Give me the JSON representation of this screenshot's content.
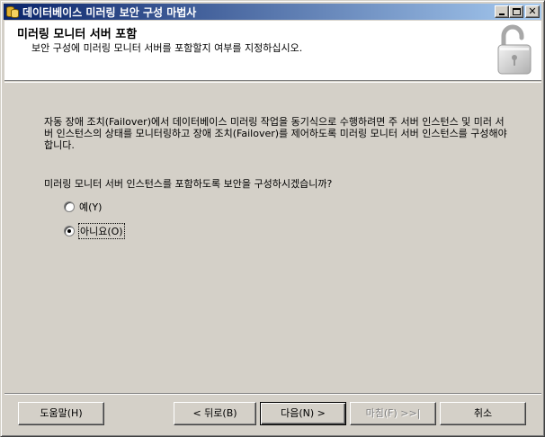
{
  "window": {
    "title": "데이터베이스 미러링 보안 구성 마법사",
    "minimize_glyph": "_",
    "maximize_glyph": "□",
    "close_glyph": "✕"
  },
  "header": {
    "title": "미러링 모니터 서버 포함",
    "subtitle": "보안 구성에 미러링 모니터 서버를 포함할지 여부를 지정하십시오.",
    "icon": "padlock-icon"
  },
  "body": {
    "description": "자동 장애 조치(Failover)에서 데이터베이스 미러링 작업을 동기식으로 수행하려면 주 서버 인스턴스 및 미러 서버 인스턴스의 상태를 모니터링하고 장애 조치(Failover)를 제어하도록 미러링 모니터 서버 인스턴스를 구성해야 합니다.",
    "question": "미러링 모니터 서버 인스턴스를 포함하도록 보안을 구성하시겠습니까?",
    "options": [
      {
        "label": "예(Y)",
        "selected": false
      },
      {
        "label": "아니요(O)",
        "selected": true
      }
    ]
  },
  "buttons": {
    "help": "도움말(H)",
    "back": "< 뒤로(B)",
    "next": "다음(N) >",
    "finish": "마침(F) >>|",
    "cancel": "취소"
  },
  "colors": {
    "titlebar_start": "#0a246a",
    "titlebar_end": "#a6caf0",
    "dialog_face": "#d4d0c8",
    "disabled_text": "#808080"
  }
}
